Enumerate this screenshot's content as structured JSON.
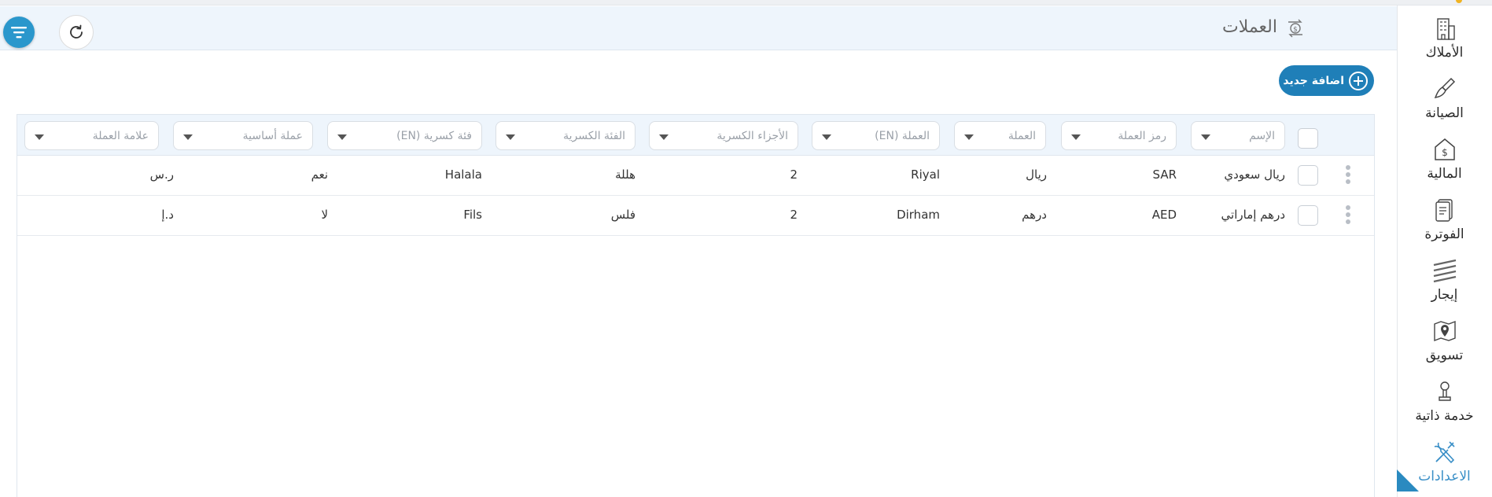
{
  "header": {
    "title": "العملات",
    "title_icon": "currency-exchange-icon",
    "filter_icon": "filter-icon",
    "refresh_icon": "refresh-icon"
  },
  "toolbar": {
    "add_label": "اضافة جديد"
  },
  "sidebar": {
    "items": [
      {
        "label": "الأملاك",
        "icon": "building-icon"
      },
      {
        "label": "الصيانة",
        "icon": "brush-icon"
      },
      {
        "label": "المالية",
        "icon": "money-house-icon"
      },
      {
        "label": "الفوترة",
        "icon": "invoice-icon"
      },
      {
        "label": "إيجار",
        "icon": "lease-icon"
      },
      {
        "label": "تسويق",
        "icon": "map-pin-icon"
      },
      {
        "label": "خدمة ذاتية",
        "icon": "self-service-icon"
      },
      {
        "label": "الاعدادات",
        "icon": "tools-icon",
        "active": true
      }
    ]
  },
  "table": {
    "columns": [
      "الإسم",
      "رمز العملة",
      "العملة",
      "العملة (EN)",
      "الأجزاء الكسرية",
      "الفئة الكسرية",
      "فئة كسرية (EN)",
      "عملة أساسية",
      "علامة العملة"
    ],
    "rows": [
      [
        "ريال سعودي",
        "SAR",
        "ريال",
        "Riyal",
        "2",
        "هللة",
        "Halala",
        "نعم",
        "ر.س"
      ],
      [
        "درهم إماراتي",
        "AED",
        "درهم",
        "Dirham",
        "2",
        "فلس",
        "Fils",
        "لا",
        "د.إ"
      ]
    ]
  },
  "colors": {
    "accent": "#1f7fb8",
    "header_bg": "#eef5fc",
    "active_sidebar": "#3a8fc7"
  }
}
